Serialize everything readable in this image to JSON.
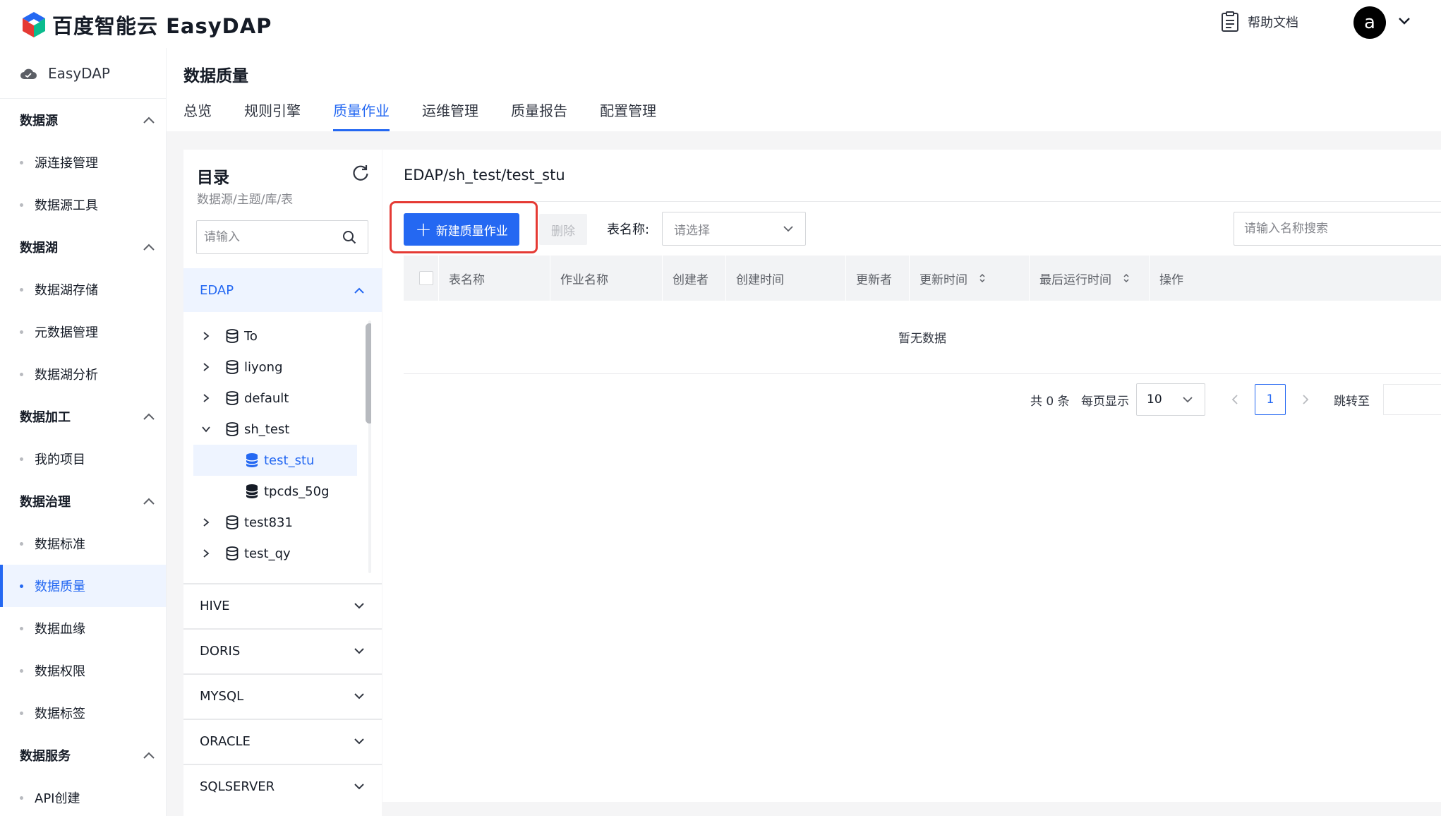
{
  "header": {
    "brand": "百度智能云 EasyDAP",
    "help_label": "帮助文档",
    "avatar_letter": "a"
  },
  "sidebar": {
    "brand_label": "EasyDAP",
    "groups": [
      {
        "label": "数据源",
        "items": [
          "源连接管理",
          "数据源工具"
        ]
      },
      {
        "label": "数据湖",
        "items": [
          "数据湖存储",
          "元数据管理",
          "数据湖分析"
        ]
      },
      {
        "label": "数据加工",
        "items": [
          "我的项目"
        ]
      },
      {
        "label": "数据治理",
        "items": [
          "数据标准",
          "数据质量",
          "数据血缘",
          "数据权限",
          "数据标签"
        ]
      },
      {
        "label": "数据服务",
        "items": [
          "API创建"
        ]
      }
    ],
    "active_item": "数据质量"
  },
  "page": {
    "title": "数据质量",
    "tabs": [
      "总览",
      "规则引擎",
      "质量作业",
      "运维管理",
      "质量报告",
      "配置管理"
    ],
    "active_tab": "质量作业"
  },
  "catalog": {
    "title": "目录",
    "subtitle": "数据源/主题/库/表",
    "search_placeholder": "请输入",
    "open_source": "EDAP",
    "tree": [
      {
        "label": "To",
        "type": "db",
        "expanded": false
      },
      {
        "label": "liyong",
        "type": "db",
        "expanded": false
      },
      {
        "label": "default",
        "type": "db",
        "expanded": false
      },
      {
        "label": "sh_test",
        "type": "db",
        "expanded": true
      },
      {
        "label": "test_stu",
        "type": "table",
        "selected": true
      },
      {
        "label": "tpcds_50g",
        "type": "table",
        "selected": false
      },
      {
        "label": "test831",
        "type": "db",
        "expanded": false
      },
      {
        "label": "test_qy",
        "type": "db",
        "expanded": false
      }
    ],
    "other_sources": [
      "HIVE",
      "DORIS",
      "MYSQL",
      "ORACLE",
      "SQLSERVER"
    ]
  },
  "main": {
    "breadcrumb": "EDAP/sh_test/test_stu",
    "new_button": "新建质量作业",
    "delete_button": "删除",
    "filter_label": "表名称:",
    "filter_placeholder": "请选择",
    "search_placeholder": "请输入名称搜索",
    "columns": [
      "表名称",
      "作业名称",
      "创建者",
      "创建时间",
      "更新者",
      "更新时间",
      "最后运行时间",
      "操作"
    ],
    "empty_text": "暂无数据",
    "pagination": {
      "total_text": "共 0 条",
      "page_size_label": "每页显示",
      "page_size": "10",
      "current_page": "1",
      "jump_label": "跳转至"
    }
  },
  "colors": {
    "accent": "#2468f2",
    "highlight": "#e53a34"
  }
}
